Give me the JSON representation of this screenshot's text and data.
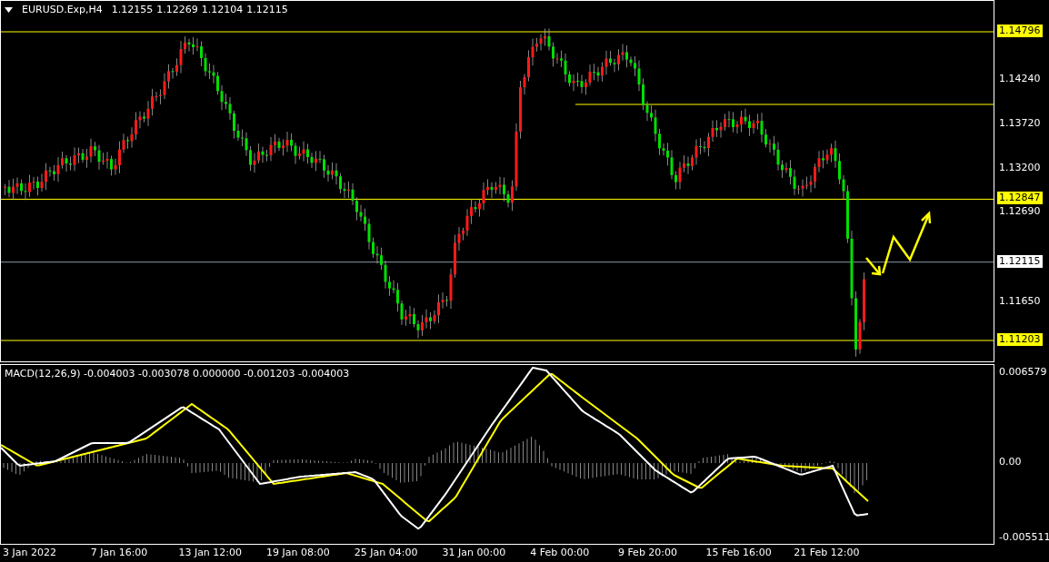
{
  "header": {
    "symbol": "EURUSD.Exp,H4",
    "quotes": [
      "1.12155",
      "1.12269",
      "1.12104",
      "1.12115"
    ]
  },
  "price_axis": [
    {
      "label": "1.14796",
      "kind": "level"
    },
    {
      "label": "1.14240",
      "kind": "tick"
    },
    {
      "label": "1.13720",
      "kind": "tick"
    },
    {
      "label": "1.13200",
      "kind": "tick"
    },
    {
      "label": "1.12847",
      "kind": "level"
    },
    {
      "label": "1.12690",
      "kind": "tick"
    },
    {
      "label": "1.12115",
      "kind": "current"
    },
    {
      "label": "1.11650",
      "kind": "tick"
    },
    {
      "label": "1.11203",
      "kind": "level"
    }
  ],
  "macd": {
    "title": "MACD(12,26,9) -0.004003 -0.003078 0.000000 -0.001203 -0.004003",
    "axis": [
      "0.006579",
      "0.00",
      "-0.005511"
    ]
  },
  "time_axis": [
    "3 Jan 2022",
    "7 Jan 16:00",
    "13 Jan 12:00",
    "19 Jan 08:00",
    "25 Jan 04:00",
    "31 Jan 00:00",
    "4 Feb 00:00",
    "9 Feb 20:00",
    "15 Feb 16:00",
    "21 Feb 12:00"
  ]
}
